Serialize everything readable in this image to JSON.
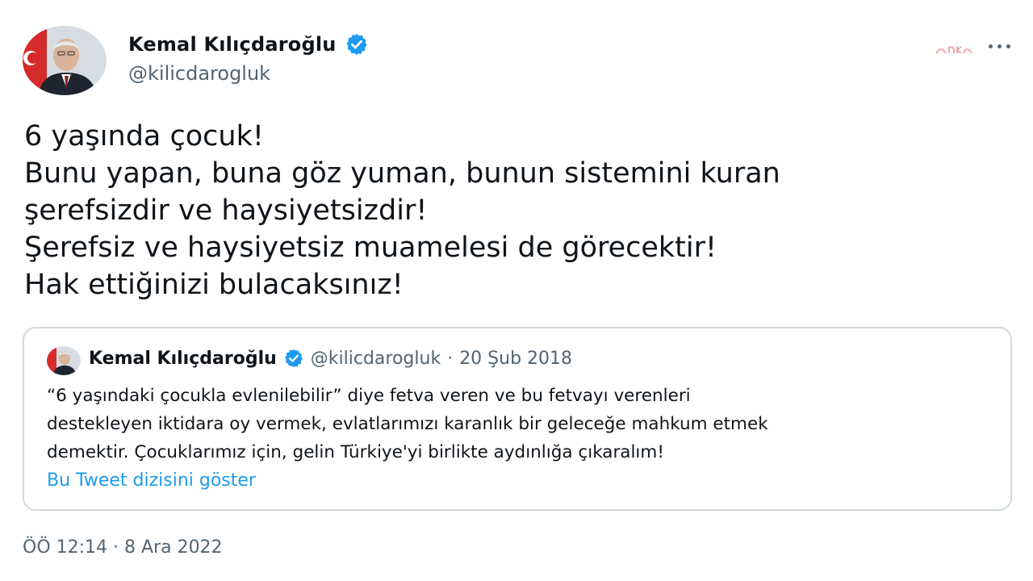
{
  "author": {
    "display_name": "Kemal Kılıçdaroğlu",
    "handle": "@kilicdarogluk",
    "avatar_icon": "profile-photo",
    "verified_icon": "verified-badge-icon"
  },
  "watermark": "anka",
  "more_icon": "more-options-icon",
  "tweet": {
    "lines": [
      "6 yaşında çocuk!",
      "Bunu yapan, buna göz yuman, bunun sistemini kuran",
      "şerefsizdir ve haysiyetsizdir!",
      "Şerefsiz ve haysiyetsiz muamelesi de görecektir!",
      "Hak ettiğinizi bulacaksınız!"
    ]
  },
  "quoted": {
    "display_name": "Kemal Kılıçdaroğlu",
    "handle": "@kilicdarogluk",
    "separator": "·",
    "date": "20 Şub 2018",
    "lines": [
      "“6 yaşındaki çocukla evlenilebilir” diye fetva veren ve bu fetvayı verenleri",
      "destekleyen iktidara oy vermek, evlatlarımızı karanlık bir geleceğe mahkum etmek",
      "demektir. Çocuklarımız için, gelin Türkiye'yi birlikte aydınlığa çıkaralım!"
    ],
    "show_thread_label": "Bu Tweet dizisini göster"
  },
  "timestamp": "ÖÖ 12:14 · 8 Ara 2022",
  "colors": {
    "verified": "#1d9bf0",
    "link": "#1d9bf0",
    "secondary_text": "#536471",
    "border": "#cfd9de"
  }
}
